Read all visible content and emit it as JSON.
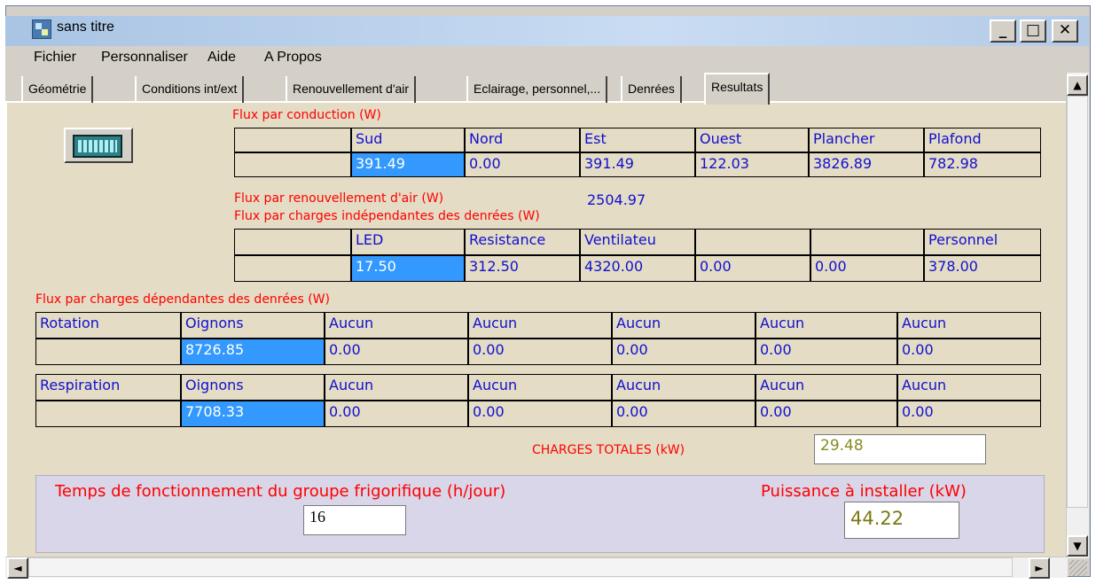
{
  "window": {
    "title": "sans titre",
    "minimize": "_",
    "maximize": "□",
    "close": "✕"
  },
  "menu": [
    "Fichier",
    "Personnaliser",
    "Aide",
    "A Propos"
  ],
  "tabs": [
    "Géométrie",
    "Conditions int/ext",
    "Renouvellement d'air",
    "Eclairage, personnel,...",
    "Denrées",
    "Resultats"
  ],
  "conduction": {
    "label": "Flux par conduction (W)",
    "headers": [
      "Sud",
      "Nord",
      "Est",
      "Ouest",
      "Plancher",
      "Plafond"
    ],
    "values": [
      "391.49",
      "0.00",
      "391.49",
      "122.03",
      "3826.89",
      "782.98"
    ]
  },
  "renouvellement": {
    "label": "Flux par renouvellement d'air (W)",
    "value": "2504.97"
  },
  "independantes": {
    "label": "Flux par charges indépendantes des denrées (W)",
    "headers": [
      "LED",
      "Resistance",
      "Ventilateu",
      "",
      "",
      "Personnel"
    ],
    "values": [
      "17.50",
      "312.50",
      "4320.00",
      "0.00",
      "0.00",
      "378.00"
    ]
  },
  "dependantes": {
    "label": "Flux par charges dépendantes des denrées (W)",
    "rotation": {
      "label": "Rotation",
      "headers": [
        "Oignons",
        "Aucun",
        "Aucun",
        "Aucun",
        "Aucun",
        "Aucun"
      ],
      "values": [
        "8726.85",
        "0.00",
        "0.00",
        "0.00",
        "0.00",
        "0.00"
      ]
    },
    "respiration": {
      "label": "Respiration",
      "headers": [
        "Oignons",
        "Aucun",
        "Aucun",
        "Aucun",
        "Aucun",
        "Aucun"
      ],
      "values": [
        "7708.33",
        "0.00",
        "0.00",
        "0.00",
        "0.00",
        "0.00"
      ]
    }
  },
  "totals": {
    "label": "CHARGES TOTALES (kW)",
    "value": "29.48"
  },
  "bottom": {
    "temps_label": "Temps de fonctionnement du groupe frigorifique (h/jour)",
    "temps_value": "16",
    "puissance_label": "Puissance à installer (kW)",
    "puissance_value": "44.22"
  },
  "scroll": {
    "up": "▲",
    "down": "▼",
    "left": "◄",
    "right": "►"
  },
  "colors": {
    "label_red": "#ff0000",
    "value_blue": "#1010d0",
    "selected": "#3399ff",
    "content_bg": "#e4dcc4"
  },
  "icons": [
    "app-icon",
    "calculator-icon"
  ]
}
